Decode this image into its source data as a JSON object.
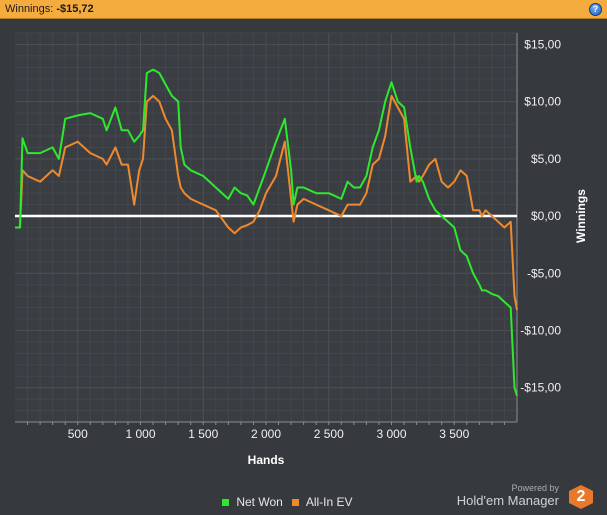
{
  "header": {
    "label": "Winnings:",
    "value": "-$15,72",
    "help_icon": "help-icon",
    "help_glyph": "?"
  },
  "legend": {
    "items": [
      {
        "label": "Net Won",
        "color": "#2ee82e"
      },
      {
        "label": "All-In EV",
        "color": "#ee8a2e"
      }
    ]
  },
  "branding": {
    "powered": "Powered by",
    "name": "Hold'em Manager",
    "logo_text": "2"
  },
  "colors": {
    "background": "#363a3e",
    "plot_background": "#3a3e43",
    "grid": "#4b4f54",
    "zero_line": "#ffffff",
    "header": "#f5ac3e"
  },
  "chart_data": {
    "type": "line",
    "xlabel": "Hands",
    "ylabel": "Winnings",
    "xlim": [
      0,
      4000
    ],
    "ylim": [
      -18,
      16
    ],
    "x_ticks": [
      500,
      1000,
      1500,
      2000,
      2500,
      3000,
      3500
    ],
    "x_tick_labels": [
      "500",
      "1 000",
      "1 500",
      "2 000",
      "2 500",
      "3 000",
      "3 500"
    ],
    "y_ticks": [
      15,
      10,
      5,
      0,
      -5,
      -10,
      -15
    ],
    "y_tick_labels": [
      "$15,00",
      "$10,00",
      "$5,00",
      "$0,00",
      "-$5,00",
      "-$10,00",
      "-$15,00"
    ],
    "grid": true,
    "legend_position": "bottom-center",
    "series": [
      {
        "name": "Net Won",
        "color": "#2ee82e",
        "x": [
          0,
          40,
          60,
          100,
          200,
          300,
          350,
          400,
          500,
          600,
          700,
          730,
          800,
          850,
          900,
          950,
          990,
          1020,
          1050,
          1100,
          1150,
          1200,
          1250,
          1300,
          1320,
          1350,
          1400,
          1500,
          1600,
          1700,
          1750,
          1800,
          1850,
          1900,
          1950,
          2000,
          2080,
          2150,
          2200,
          2220,
          2250,
          2300,
          2400,
          2500,
          2600,
          2650,
          2700,
          2750,
          2800,
          2850,
          2900,
          2950,
          3000,
          3050,
          3100,
          3150,
          3200,
          3220,
          3250,
          3300,
          3350,
          3400,
          3450,
          3500,
          3550,
          3600,
          3650,
          3700,
          3720,
          3750,
          3800,
          3850,
          3900,
          3950,
          3980,
          4000
        ],
        "values": [
          -1.0,
          -1.0,
          6.8,
          5.5,
          5.5,
          6.0,
          5.0,
          8.5,
          8.8,
          9.0,
          8.5,
          7.5,
          9.5,
          7.5,
          7.5,
          6.5,
          7.0,
          7.5,
          12.5,
          12.8,
          12.5,
          11.5,
          10.5,
          10.0,
          6.0,
          4.5,
          4.0,
          3.5,
          2.5,
          1.5,
          2.5,
          2.0,
          1.8,
          1.0,
          2.5,
          4.0,
          6.5,
          8.5,
          4.0,
          1.0,
          2.5,
          2.5,
          2.0,
          2.0,
          1.5,
          3.0,
          2.5,
          2.5,
          3.5,
          6.0,
          7.5,
          10.0,
          11.7,
          10.0,
          9.5,
          6.0,
          3.0,
          3.5,
          3.0,
          1.5,
          0.5,
          0.0,
          -0.5,
          -1.0,
          -3.0,
          -3.5,
          -5.0,
          -6.0,
          -6.5,
          -6.5,
          -6.8,
          -7.0,
          -7.5,
          -8.0,
          -15.0,
          -15.7
        ]
      },
      {
        "name": "All-In EV",
        "color": "#ee8a2e",
        "x": [
          0,
          40,
          60,
          100,
          200,
          300,
          350,
          400,
          500,
          600,
          700,
          730,
          800,
          850,
          900,
          950,
          990,
          1020,
          1050,
          1100,
          1150,
          1200,
          1250,
          1300,
          1320,
          1350,
          1400,
          1500,
          1600,
          1700,
          1750,
          1800,
          1850,
          1900,
          1950,
          2000,
          2080,
          2150,
          2200,
          2220,
          2250,
          2300,
          2400,
          2500,
          2600,
          2650,
          2700,
          2750,
          2800,
          2850,
          2900,
          2950,
          3000,
          3050,
          3100,
          3150,
          3200,
          3220,
          3250,
          3300,
          3350,
          3400,
          3450,
          3500,
          3550,
          3600,
          3650,
          3700,
          3720,
          3750,
          3800,
          3850,
          3900,
          3950,
          3980,
          4000
        ],
        "values": [
          -1.0,
          -1.0,
          4.0,
          3.5,
          3.0,
          4.0,
          3.5,
          6.0,
          6.5,
          5.5,
          5.0,
          4.5,
          6.0,
          4.5,
          4.5,
          1.0,
          4.0,
          5.0,
          10.0,
          10.5,
          10.0,
          8.5,
          7.5,
          3.5,
          2.5,
          2.0,
          1.5,
          1.0,
          0.5,
          -1.0,
          -1.5,
          -1.0,
          -0.8,
          -0.5,
          0.5,
          2.0,
          3.5,
          6.5,
          1.5,
          -0.5,
          1.0,
          1.5,
          1.0,
          0.5,
          0.0,
          1.0,
          1.0,
          1.0,
          2.0,
          4.5,
          5.0,
          7.0,
          10.5,
          9.5,
          8.5,
          3.0,
          3.5,
          3.0,
          3.5,
          4.5,
          5.0,
          3.0,
          2.5,
          3.0,
          4.0,
          3.5,
          0.5,
          0.5,
          0.0,
          0.5,
          0.0,
          -0.5,
          -1.0,
          -0.5,
          -7.0,
          -8.2
        ]
      }
    ]
  }
}
